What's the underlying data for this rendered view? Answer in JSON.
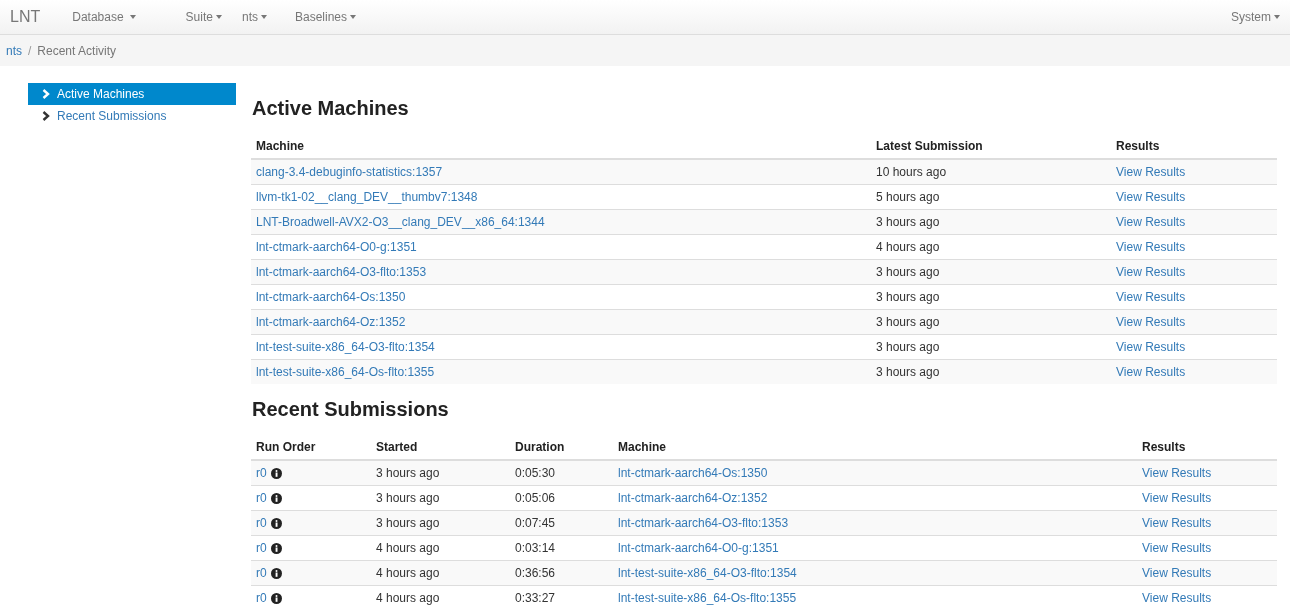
{
  "navbar": {
    "brand": "LNT",
    "menus": [
      {
        "label": "Database"
      },
      {
        "label": "Suite"
      },
      {
        "label": "nts"
      },
      {
        "label": "Baselines"
      }
    ],
    "right_menu": {
      "label": "System"
    }
  },
  "breadcrumb": [
    {
      "label": "nts",
      "kind": "link"
    },
    {
      "label": "/",
      "kind": "separator"
    },
    {
      "label": "Recent Activity",
      "kind": "current"
    }
  ],
  "sidebar": {
    "items": [
      {
        "label": "Active Machines",
        "selected": true
      },
      {
        "label": "Recent Submissions",
        "selected": false
      }
    ]
  },
  "active_machines": {
    "title": "Active Machines",
    "columns": [
      "Machine",
      "Latest Submission",
      "Results"
    ],
    "rows": [
      {
        "machine": "clang-3.4-debuginfo-statistics:1357",
        "latest": "10 hours ago",
        "results": "View Results"
      },
      {
        "machine": "llvm-tk1-02__clang_DEV__thumbv7:1348",
        "latest": "5 hours ago",
        "results": "View Results"
      },
      {
        "machine": "LNT-Broadwell-AVX2-O3__clang_DEV__x86_64:1344",
        "latest": "3 hours ago",
        "results": "View Results"
      },
      {
        "machine": "lnt-ctmark-aarch64-O0-g:1351",
        "latest": "4 hours ago",
        "results": "View Results"
      },
      {
        "machine": "lnt-ctmark-aarch64-O3-flto:1353",
        "latest": "3 hours ago",
        "results": "View Results"
      },
      {
        "machine": "lnt-ctmark-aarch64-Os:1350",
        "latest": "3 hours ago",
        "results": "View Results"
      },
      {
        "machine": "lnt-ctmark-aarch64-Oz:1352",
        "latest": "3 hours ago",
        "results": "View Results"
      },
      {
        "machine": "lnt-test-suite-x86_64-O3-flto:1354",
        "latest": "3 hours ago",
        "results": "View Results"
      },
      {
        "machine": "lnt-test-suite-x86_64-Os-flto:1355",
        "latest": "3 hours ago",
        "results": "View Results"
      }
    ]
  },
  "recent_submissions": {
    "title": "Recent Submissions",
    "columns": [
      "Run Order",
      "Started",
      "Duration",
      "Machine",
      "Results"
    ],
    "rows": [
      {
        "run_order": "r0",
        "started": "3 hours ago",
        "duration": "0:05:30",
        "machine": "lnt-ctmark-aarch64-Os:1350",
        "results": "View Results"
      },
      {
        "run_order": "r0",
        "started": "3 hours ago",
        "duration": "0:05:06",
        "machine": "lnt-ctmark-aarch64-Oz:1352",
        "results": "View Results"
      },
      {
        "run_order": "r0",
        "started": "3 hours ago",
        "duration": "0:07:45",
        "machine": "lnt-ctmark-aarch64-O3-flto:1353",
        "results": "View Results"
      },
      {
        "run_order": "r0",
        "started": "4 hours ago",
        "duration": "0:03:14",
        "machine": "lnt-ctmark-aarch64-O0-g:1351",
        "results": "View Results"
      },
      {
        "run_order": "r0",
        "started": "4 hours ago",
        "duration": "0:36:56",
        "machine": "lnt-test-suite-x86_64-O3-flto:1354",
        "results": "View Results"
      },
      {
        "run_order": "r0",
        "started": "4 hours ago",
        "duration": "0:33:27",
        "machine": "lnt-test-suite-x86_64-Os-flto:1355",
        "results": "View Results"
      }
    ]
  }
}
